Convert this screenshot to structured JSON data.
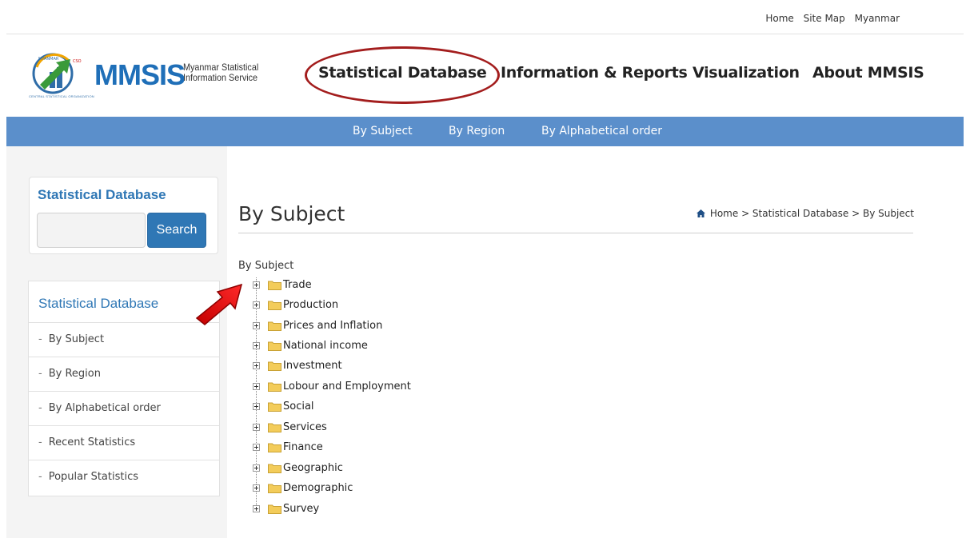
{
  "top_links": [
    "Home",
    "Site Map",
    "Myanmar"
  ],
  "logo": {
    "name": "MMSIS",
    "subtitle_line1": "Myanmar Statistical",
    "subtitle_line2": "Information Service",
    "caption": "CENTRAL STATISTICAL ORGANIZATION"
  },
  "main_nav": [
    "Statistical Database",
    "Information & Reports",
    "Visualization",
    "About MMSIS"
  ],
  "sub_nav": [
    "By Subject",
    "By Region",
    "By Alphabetical order"
  ],
  "search": {
    "title": "Statistical Database",
    "button": "Search",
    "value": ""
  },
  "sidebar": {
    "title": "Statistical Database",
    "items": [
      "By Subject",
      "By Region",
      "By Alphabetical order",
      "Recent Statistics",
      "Popular Statistics"
    ]
  },
  "content": {
    "title": "By Subject",
    "breadcrumb": "Home > Statistical Database > By Subject",
    "tree_root": "By Subject",
    "tree_items": [
      "Trade",
      "Production",
      "Prices and Inflation",
      "National income",
      "Investment",
      "Lobour and Employment",
      "Social",
      "Services",
      "Finance",
      "Geographic",
      "Demographic",
      "Survey"
    ]
  },
  "colors": {
    "accent_blue": "#2f77b5",
    "subnav_blue": "#5b8fcb",
    "highlight_red": "#a31d1d",
    "folder_yellow": "#f3cc5a"
  }
}
